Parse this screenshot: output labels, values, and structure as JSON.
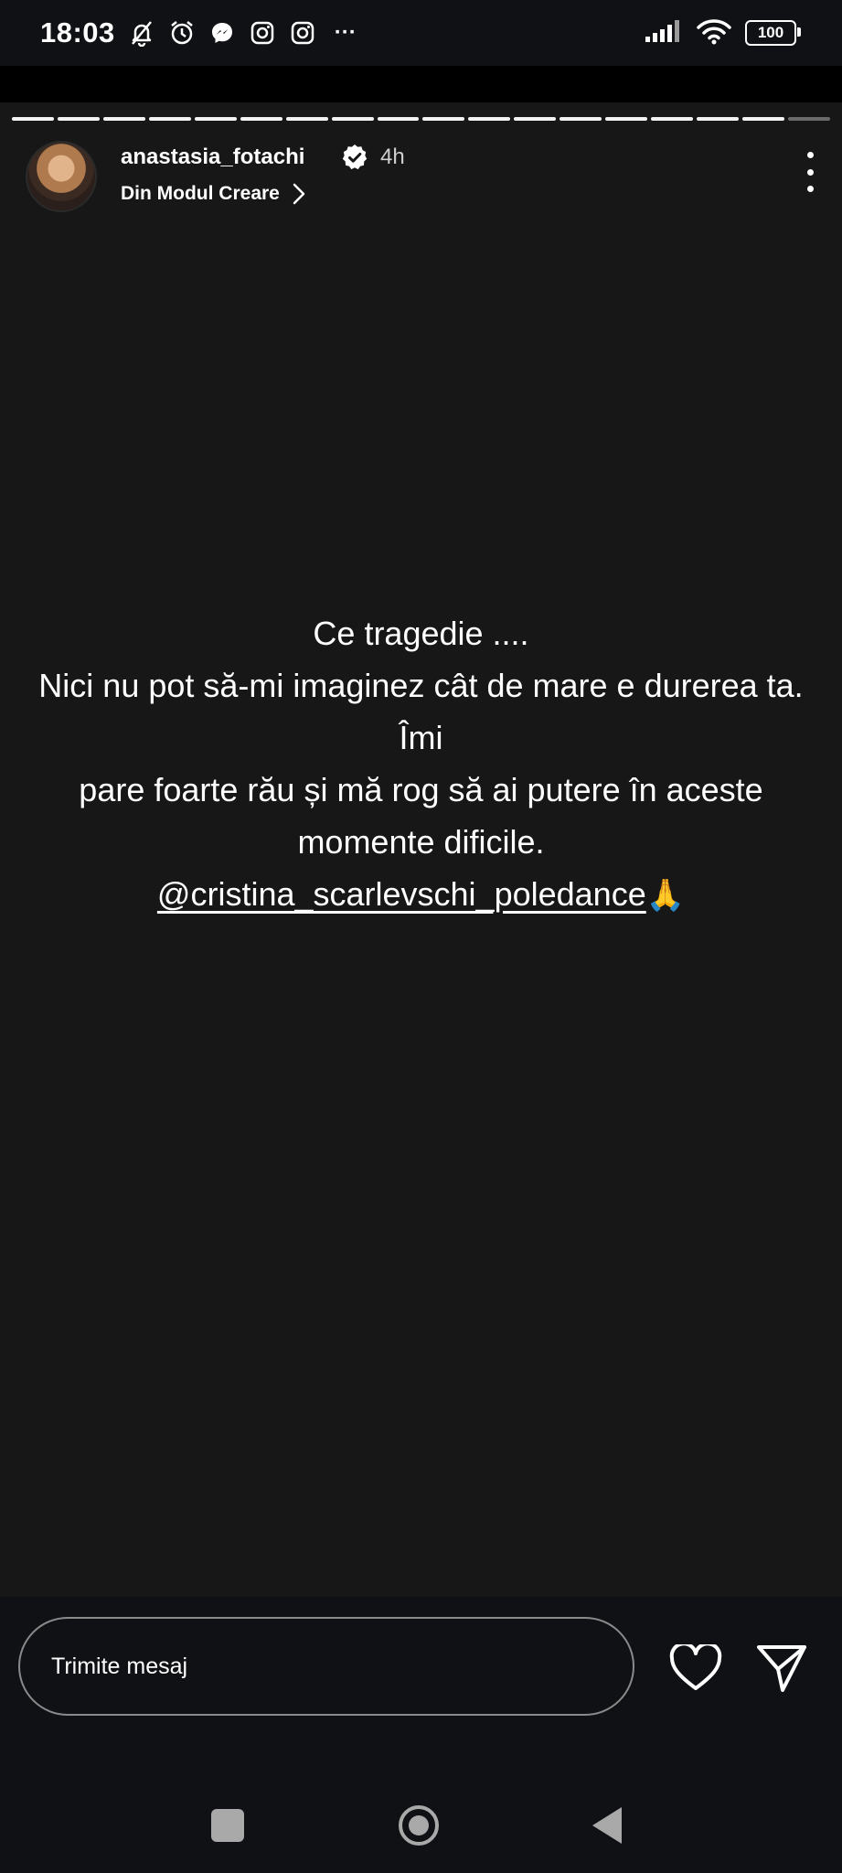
{
  "status_bar": {
    "time": "18:03",
    "overflow": "···",
    "battery": "100",
    "icons": [
      "bell-off-icon",
      "alarm-icon",
      "messenger-icon",
      "instagram-icon",
      "instagram-icon",
      "signal-icon",
      "wifi-icon",
      "battery-icon"
    ]
  },
  "story": {
    "progress_total_segments": 18,
    "progress_active_index": 17,
    "username": "anastasia_fotachi",
    "time_ago": "4h",
    "creator_mode_label": "Din Modul Creare",
    "caption_lines": [
      "Ce tragedie ....",
      "Nici nu pot să-mi imaginez cât de mare e durerea ta. Îmi",
      "pare foarte rău și mă rog să ai putere în aceste",
      "momente dificile."
    ],
    "mention": "@cristina_scarlevschi_poledance",
    "emoji": "🙏"
  },
  "reply": {
    "placeholder": "Trimite mesaj"
  },
  "colors": {
    "story_bg": "#171717",
    "bar_bg": "#0f1115",
    "text": "#ffffff",
    "progress_done": "#f2f2f2",
    "progress_pending": "#6b6b6b"
  }
}
